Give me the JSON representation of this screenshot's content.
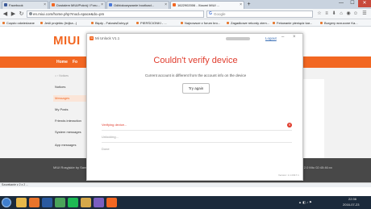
{
  "browser": {
    "tabs": [
      {
        "label": "Facebook",
        "color": "#3b5998"
      },
      {
        "label": "Dostalem MIUI/Pokrój / Foru...",
        "color": "#f26722"
      },
      {
        "label": "Odblokowywanie bootload...",
        "color": "#4a78d8"
      },
      {
        "label": "1622902006 - Xiaomi MIUI ...",
        "color": "#f26722"
      }
    ],
    "new_tab": "+",
    "url": "en.miui.com/home.php?mod=space&do=pm",
    "search_placeholder": "Google",
    "window_controls": {
      "minimize": "—",
      "maximize": "☐",
      "close": "✕"
    }
  },
  "bookmarks": [
    "Często odwiedzane",
    "Jeśli projektu (trójka...)",
    "Błędy - FalowisDolny.pl",
    "PIERŚCIONKI - ...",
    "Najnowsze z forum bro...",
    "Zagadkowe rekordy ziem...",
    "Fetowanie pieniądz kar...",
    "Burgery wrzucone Ka..."
  ],
  "miui": {
    "logo": "MIUI",
    "nav": [
      "Home",
      "Fo"
    ],
    "breadcrumb": "Notices",
    "left_menu": [
      "Notices",
      "Messages",
      "My Posts",
      "Friends interaction",
      "System messages",
      "App messages"
    ],
    "active_menu_index": 1,
    "footer_left": "MIUI Rosyjskie by Sami Firmy",
    "footer_links": [
      "MIUI Official Site",
      "Mi Official Site",
      "User Agreement",
      "Privacy Policy",
      "Mobile"
    ],
    "footer_right": "Copyright © 2017 MIUI Rom by 2.0 Mto 02:45:46:xx"
  },
  "dialog": {
    "title": "Mi Unlock V1.1",
    "logout": "Logout",
    "heading": "Couldn't verify device",
    "subtitle": "Current account is different from the account info on the device",
    "button": "Try again",
    "steps": [
      {
        "label": "Verifying device...",
        "state": "error",
        "color": "#e03b2c"
      },
      {
        "label": "Unlocking...",
        "state": "pending",
        "color": "#999999"
      },
      {
        "label": "Done",
        "state": "pending",
        "color": "#999999"
      }
    ],
    "version": "Version: 1.1.0317.1"
  },
  "download_bar": "Szczekanie z 2 z 2 ...",
  "taskbar": {
    "apps": [
      "file-explorer-icon",
      "firefox-icon",
      "photoshop-icon",
      "chrome-icon",
      "spotify-icon",
      "folder-icon",
      "paint-icon",
      "mi-unlock-icon"
    ],
    "clock_time": "22:36",
    "clock_date": "2016-07-23"
  },
  "colors": {
    "brand": "#f26722",
    "error": "#e03b2c"
  }
}
